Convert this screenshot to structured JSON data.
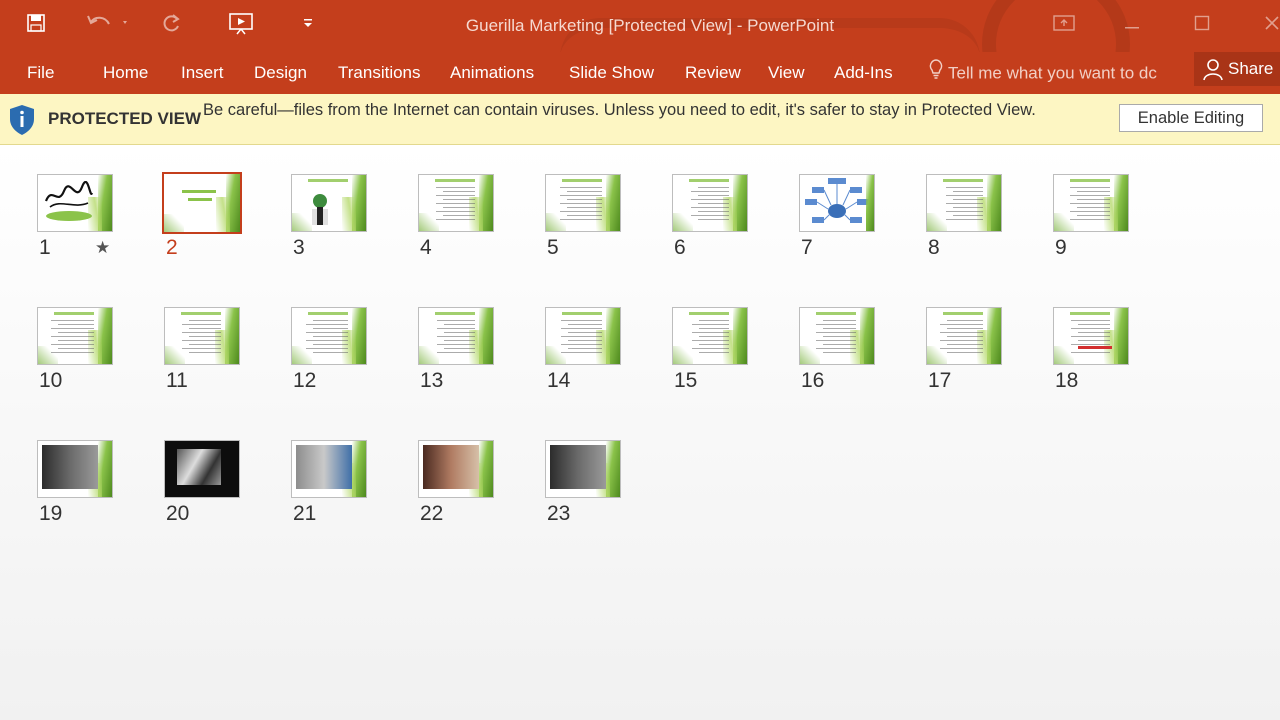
{
  "window": {
    "title": "Guerilla Marketing [Protected View] - PowerPoint"
  },
  "ribbon": {
    "tabs": [
      "File",
      "Home",
      "Insert",
      "Design",
      "Transitions",
      "Animations",
      "Slide Show",
      "Review",
      "View",
      "Add-Ins"
    ],
    "tell_me": "Tell me what you want to dc",
    "share": "Share"
  },
  "protected_view": {
    "title": "PROTECTED VIEW",
    "message": "Be careful—files from the Internet can contain viruses. Unless you need to edit, it's safer to stay in Protected View.",
    "enable_button": "Enable Editing"
  },
  "slides": [
    {
      "number": "1",
      "kind": "calligraphy",
      "has_animation_star": true
    },
    {
      "number": "2",
      "kind": "title",
      "selected": true
    },
    {
      "number": "3",
      "kind": "figure"
    },
    {
      "number": "4",
      "kind": "text"
    },
    {
      "number": "5",
      "kind": "text"
    },
    {
      "number": "6",
      "kind": "text"
    },
    {
      "number": "7",
      "kind": "diagram"
    },
    {
      "number": "8",
      "kind": "text"
    },
    {
      "number": "9",
      "kind": "text"
    },
    {
      "number": "10",
      "kind": "text"
    },
    {
      "number": "11",
      "kind": "text"
    },
    {
      "number": "12",
      "kind": "text"
    },
    {
      "number": "13",
      "kind": "text"
    },
    {
      "number": "14",
      "kind": "text"
    },
    {
      "number": "15",
      "kind": "text"
    },
    {
      "number": "16",
      "kind": "text"
    },
    {
      "number": "17",
      "kind": "text"
    },
    {
      "number": "18",
      "kind": "redline"
    },
    {
      "number": "19",
      "kind": "photo"
    },
    {
      "number": "20",
      "kind": "dark-photo"
    },
    {
      "number": "21",
      "kind": "photo"
    },
    {
      "number": "22",
      "kind": "photo"
    },
    {
      "number": "23",
      "kind": "photo"
    }
  ],
  "colors": {
    "accent": "#c43e1c",
    "protected_bar": "#fdf6c3",
    "slide_green": "#8bc34a"
  },
  "icons": {
    "save": "save-icon",
    "undo": "undo-icon",
    "redo": "redo-icon",
    "present": "present-from-start-icon",
    "customize": "customize-qat-icon",
    "lightbulb": "lightbulb-icon",
    "user": "user-icon",
    "shield": "shield-info-icon",
    "star": "animation-star-icon"
  }
}
